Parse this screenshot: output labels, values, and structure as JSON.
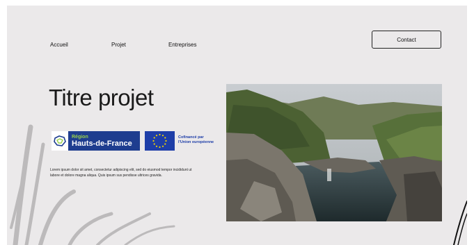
{
  "nav": {
    "items": [
      "Accueil",
      "Projet",
      "Entreprises"
    ],
    "contact_label": "Contact"
  },
  "hero": {
    "title": "Titre projet",
    "description": "Lorem ipsum dolor sit amet, consectetur adipiscing elit, sed do eiusmod tempor incididunt ut labore et dolore magna aliqua. Quis ipsum sus pendisse ultrices gravida."
  },
  "logos": {
    "region": {
      "line1": "Région",
      "line2": "Hauts-de-France"
    },
    "eu": {
      "line1": "Cofinancé par",
      "line2": "l'Union européenne"
    }
  },
  "image": {
    "subject": "coastal-cliffs-landscape-photo"
  },
  "colors": {
    "background": "#ebe9ea",
    "region_blue": "#1e3d8f",
    "region_green": "#9ad14b",
    "eu_blue": "#1e3ea8",
    "eu_star": "#f5d400"
  }
}
